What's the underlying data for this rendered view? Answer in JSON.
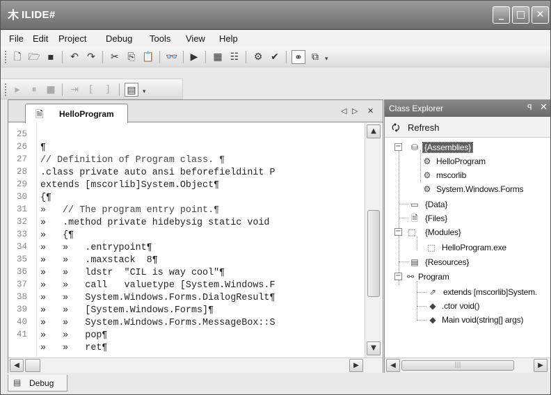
{
  "window": {
    "title": "ILIDE#",
    "app_icon": "app-icon"
  },
  "menu": {
    "items": [
      {
        "label": "File"
      },
      {
        "label": "Edit"
      },
      {
        "label": "Project"
      },
      {
        "label": "Debug"
      },
      {
        "label": "Tools"
      },
      {
        "label": "View"
      },
      {
        "label": "Help"
      }
    ]
  },
  "toolbar1": {
    "icons": [
      "new-file-icon",
      "open-folder-icon",
      "save-icon",
      "undo-icon",
      "redo-icon",
      "cut-icon",
      "copy-icon",
      "paste-icon",
      "find-icon",
      "run-icon",
      "build-icon",
      "properties-icon",
      "options-icon",
      "check-icon",
      "toggle-icon",
      "class-view-icon"
    ]
  },
  "toolbar2": {
    "icons": [
      "play-icon",
      "pause-icon",
      "stop-icon",
      "indent-icon",
      "comment-icon",
      "uncomment-icon",
      "window-icon"
    ]
  },
  "editor": {
    "tab_label": "HelloProgram",
    "lines": [
      {
        "num": "25",
        "text": "¶",
        "partial": true
      },
      {
        "num": "26",
        "text": "// Definition of Program class. ¶"
      },
      {
        "num": "27",
        "text": ".class private auto ansi beforefieldinit P"
      },
      {
        "num": "28",
        "text": "extends [mscorlib]System.Object¶"
      },
      {
        "num": "29",
        "text": "{¶"
      },
      {
        "num": "30",
        "text": "»   // The program entry point.¶"
      },
      {
        "num": "31",
        "text": "»   .method private hidebysig static void"
      },
      {
        "num": "32",
        "text": "»   {¶"
      },
      {
        "num": "33",
        "text": "»   »   .entrypoint¶"
      },
      {
        "num": "34",
        "text": "»   »   .maxstack  8¶"
      },
      {
        "num": "35",
        "text": "»   »   ldstr  \"CIL is way cool\"¶"
      },
      {
        "num": "36",
        "text": "»   »   call   valuetype [System.Windows.F"
      },
      {
        "num": "37",
        "text": "»   »   System.Windows.Forms.DialogResult¶"
      },
      {
        "num": "38",
        "text": "»   »   [System.Windows.Forms]¶"
      },
      {
        "num": "39",
        "text": "»   »   System.Windows.Forms.MessageBox::S"
      },
      {
        "num": "40",
        "text": "»   »   pop¶"
      },
      {
        "num": "41",
        "text": "»   »   ret¶",
        "partial": true
      }
    ]
  },
  "class_explorer": {
    "title": "Class Explorer",
    "refresh_label": "Refresh",
    "nodes": [
      {
        "label": "{Assemblies}",
        "selected": true
      },
      {
        "label": "HelloProgram"
      },
      {
        "label": "mscorlib"
      },
      {
        "label": "System.Windows.Forms"
      },
      {
        "label": "{Data}"
      },
      {
        "label": "{Files}"
      },
      {
        "label": "{Modules}"
      },
      {
        "label": "HelloProgram.exe"
      },
      {
        "label": "{Resources}"
      },
      {
        "label": "Program"
      },
      {
        "label": "extends [mscorlib]System."
      },
      {
        "label": ".ctor void()"
      },
      {
        "label": "Main void(string[] args)"
      }
    ]
  },
  "bottom": {
    "tab_label": "Debug"
  }
}
